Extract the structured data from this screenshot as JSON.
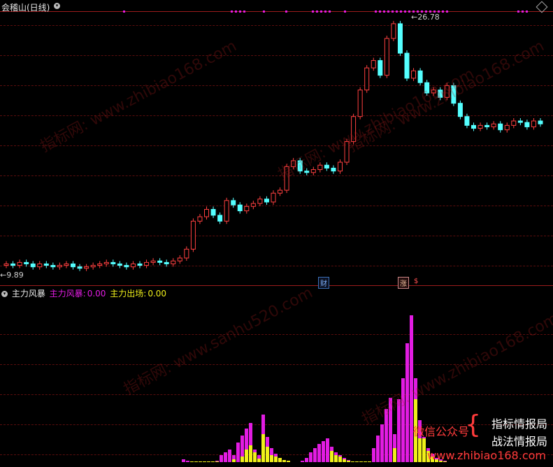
{
  "header": {
    "stock_title": "会稽山(日线)",
    "collapse_icon": "chevron-down-icon"
  },
  "price": {
    "high_label": "26.78",
    "low_label": "9.89",
    "high_arrow": "←",
    "low_arrow": "←"
  },
  "events": {
    "cai": "财",
    "zhang": "涨",
    "s": "$"
  },
  "indicator": {
    "name": "主力风暴",
    "storm_label": "主力风暴:",
    "storm_value": "0.00",
    "exit_label": "主力出场:",
    "exit_value": "0.00",
    "colors": {
      "storm": "#e21ce2",
      "exit": "#f0f01a"
    }
  },
  "watermarks": [
    "指标网: www.zhibiao168.com",
    "指标网: www.zhibiao168.com",
    "指标网: www.zhibiao168.com",
    "指标网: www.sanhu520.com",
    "指标网: www.zhibiao168.com"
  ],
  "promo": {
    "left": "微信公众号",
    "right1": "指标情报局",
    "right2": "战法情报局",
    "url": "www.zhibiao168.com"
  },
  "colors": {
    "up": "#ff4040",
    "down": "#54ffff",
    "grid": "#5a0d0d",
    "marker": "#e21ce2"
  },
  "chart_data": {
    "type": "candlestick",
    "price_series": [
      10.2,
      10.1,
      10.3,
      10.2,
      10.0,
      10.2,
      10.1,
      10.0,
      10.1,
      10.2,
      10.0,
      9.9,
      10.0,
      10.1,
      10.2,
      10.3,
      10.2,
      10.1,
      10.0,
      10.2,
      10.1,
      10.3,
      10.4,
      10.3,
      10.2,
      10.4,
      10.6,
      11.2,
      13.1,
      13.4,
      13.9,
      13.5,
      13.1,
      14.5,
      14.2,
      13.8,
      14.1,
      14.3,
      14.6,
      14.4,
      15.0,
      15.2,
      16.8,
      17.2,
      16.5,
      16.4,
      16.6,
      16.9,
      16.7,
      16.5,
      17.1,
      18.5,
      20.2,
      22.0,
      23.5,
      24.0,
      23.0,
      25.5,
      26.5,
      24.5,
      22.8,
      23.3,
      22.5,
      21.8,
      22.0,
      21.5,
      22.3,
      21.1,
      20.2,
      19.6,
      19.4,
      19.6,
      19.5,
      19.7,
      19.3,
      19.6,
      19.9,
      19.8,
      19.5,
      19.9,
      19.7
    ],
    "storm_values": [
      0,
      0,
      0,
      0,
      0,
      0,
      0,
      0,
      0,
      0,
      0,
      0,
      0,
      0,
      0,
      0,
      0,
      0,
      0,
      0,
      0,
      0,
      0,
      0,
      0,
      0,
      0,
      0,
      0,
      0,
      0,
      0,
      0,
      0,
      0,
      0,
      0,
      0,
      0,
      0,
      0,
      0,
      0,
      0,
      0,
      0,
      0,
      0,
      0,
      0,
      0,
      0,
      0,
      0,
      2,
      3,
      5,
      8,
      12,
      16,
      20,
      24,
      28,
      30,
      33,
      0,
      0,
      0,
      0,
      0,
      0,
      0,
      0,
      0,
      0,
      0,
      0,
      0,
      0,
      0,
      0
    ],
    "exit_values": [
      0,
      0,
      0,
      0,
      0,
      0,
      0,
      0,
      0,
      0,
      0,
      0,
      0,
      0,
      0,
      0,
      0,
      0,
      0,
      0,
      0,
      0,
      0,
      0,
      0,
      0,
      0,
      0,
      0,
      0,
      0,
      0,
      0,
      0,
      0,
      0,
      0,
      0,
      0,
      0,
      0,
      0,
      0,
      0,
      0,
      0,
      0,
      0,
      0,
      0,
      0,
      0,
      0,
      0,
      0,
      0,
      0,
      0,
      0,
      0,
      0,
      0,
      0,
      18,
      28,
      20,
      14,
      8,
      4,
      2,
      0,
      0,
      0,
      0,
      0,
      0,
      0,
      0,
      0,
      0,
      0
    ]
  }
}
